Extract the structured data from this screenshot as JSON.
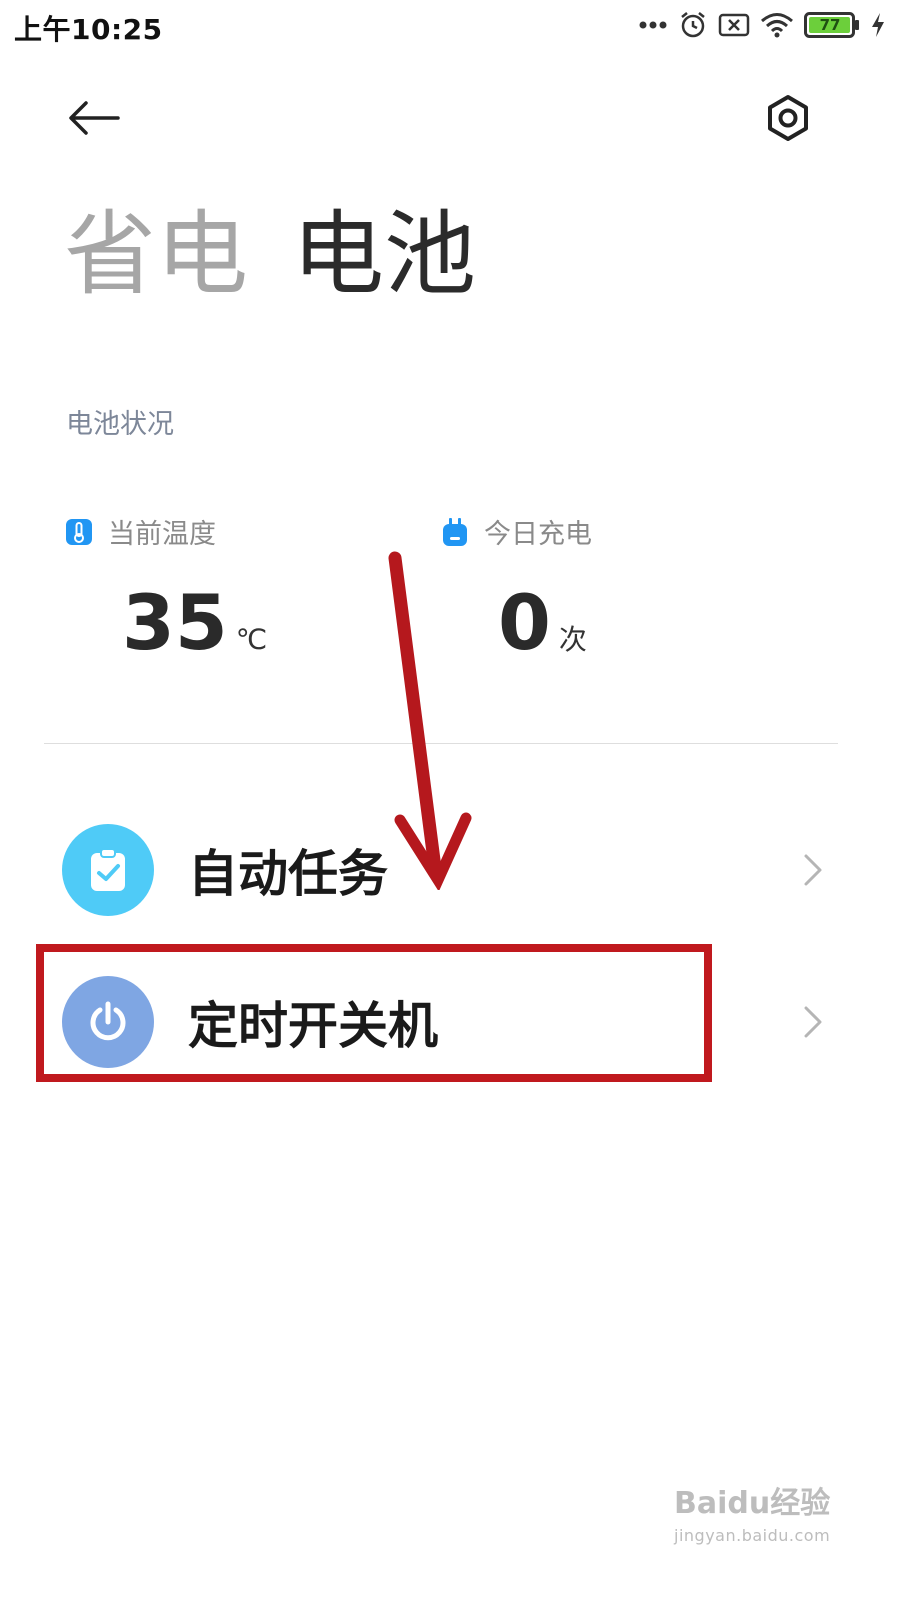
{
  "status_bar": {
    "time": "上午10:25",
    "battery_level": "77",
    "battery_color": "#6ccf3b",
    "icons": [
      "more-dots-icon",
      "alarm-icon",
      "sim-off-icon",
      "wifi-icon",
      "battery-icon",
      "charging-icon"
    ]
  },
  "header": {
    "back_icon": "back-arrow-icon",
    "settings_icon": "settings-hex-icon",
    "tabs": [
      {
        "label": "省电",
        "active": false
      },
      {
        "label": "电池",
        "active": true
      }
    ]
  },
  "battery_status": {
    "title": "电池状况",
    "stats": [
      {
        "label": "当前温度",
        "value": "35",
        "unit": "℃",
        "icon": "thermometer-icon"
      },
      {
        "label": "今日充电",
        "value": "0",
        "unit": "次",
        "icon": "charging-plug-icon"
      }
    ]
  },
  "menu": {
    "items": [
      {
        "label": "自动任务",
        "icon": "clipboard-check-icon",
        "icon_color": "#4fcbf7"
      },
      {
        "label": "定时开关机",
        "icon": "power-icon",
        "icon_color": "#7fa6e3"
      }
    ]
  },
  "annotation": {
    "highlight_color": "#c0191e",
    "arrow_color": "#b5181d"
  },
  "watermark": {
    "main": "Baidu经验",
    "sub": "jingyan.baidu.com"
  }
}
